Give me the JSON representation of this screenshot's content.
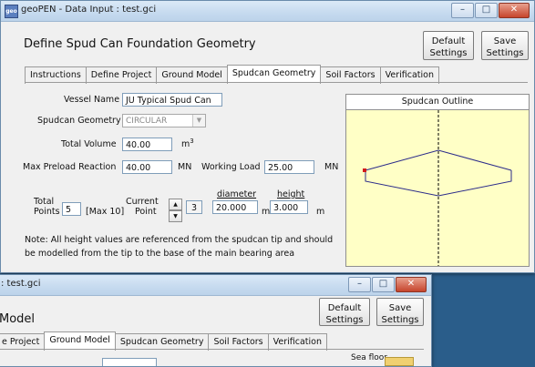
{
  "main_window": {
    "title": "geoPEN - Data Input : test.gci",
    "app_icon_text": "geo",
    "heading": "Define Spud Can Foundation Geometry",
    "default_settings": "Default Settings",
    "save_settings": "Save Settings",
    "tabs": [
      "Instructions",
      "Define Project",
      "Ground Model",
      "Spudcan Geometry",
      "Soil Factors",
      "Verification"
    ],
    "active_tab": "Spudcan Geometry",
    "form": {
      "vessel_name_label": "Vessel Name",
      "vessel_name_value": "JU Typical Spud Can",
      "geometry_label": "Spudcan Geometry",
      "geometry_value": "CIRCULAR",
      "volume_label": "Total Volume",
      "volume_value": "40.00",
      "volume_unit": "m",
      "volume_unit_sup": "3",
      "preload_label": "Max Preload Reaction",
      "preload_value": "40.00",
      "preload_unit": "MN",
      "working_label": "Working Load",
      "working_value": "25.00",
      "working_unit": "MN",
      "total_points_label_1": "Total",
      "total_points_label_2": "Points",
      "total_points_value": "5",
      "max_label": "[Max 10]",
      "current_label_1": "Current",
      "current_label_2": "Point",
      "current_point_value": "3",
      "diameter_label": "diameter",
      "diameter_value": "20.000",
      "diameter_unit": "m",
      "height_label": "height",
      "height_value": "3.000",
      "height_unit": "m",
      "note_line1": "Note: All height values are referenced from the spudcan tip and should",
      "note_line2": "be modelled from the tip to the base of the main bearing area"
    },
    "outline_title": "Spudcan Outline",
    "colors": {
      "outline_bg": "#ffffc6",
      "outline_stroke": "#2b2b8a",
      "point_marker": "#d21a1a"
    }
  },
  "back_window": {
    "title": ": test.gci",
    "heading": "Model",
    "default_settings": "Default Settings",
    "save_settings": "Save Settings",
    "tabs": [
      "e Project",
      "Ground Model",
      "Spudcan Geometry",
      "Soil Factors",
      "Verification"
    ],
    "active_tab": "Ground Model",
    "sea_floor_label": "Sea floor"
  }
}
